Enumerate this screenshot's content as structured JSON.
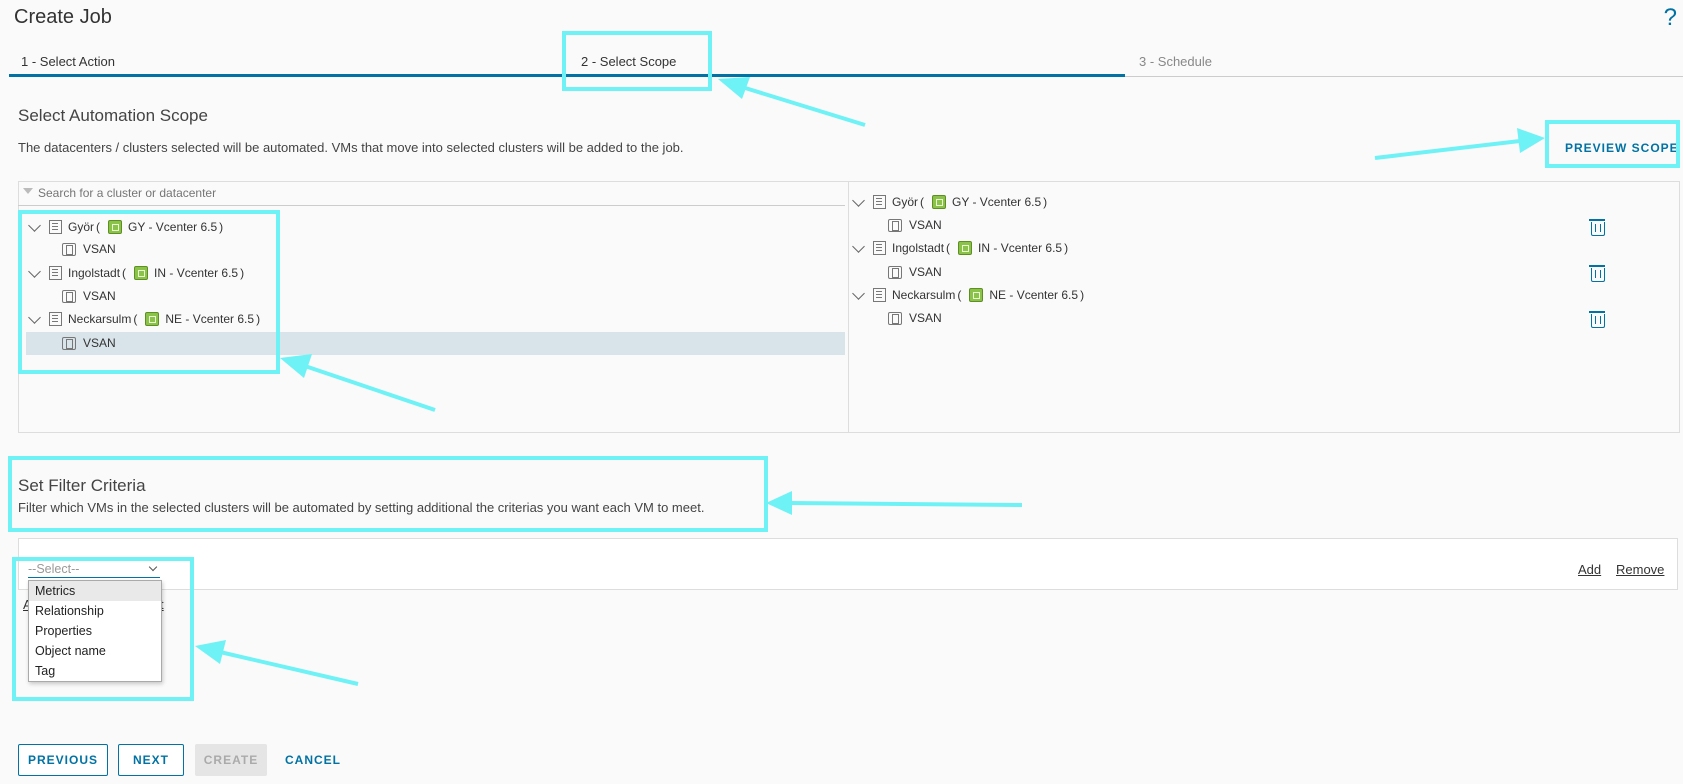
{
  "header": {
    "title": "Create Job",
    "help": "?"
  },
  "steps": [
    {
      "label": "1 - Select Action"
    },
    {
      "label": "2 - Select Scope"
    },
    {
      "label": "3 - Schedule"
    }
  ],
  "scope": {
    "heading": "Select Automation Scope",
    "description": "The datacenters / clusters selected will be automated. VMs that move into selected clusters will be added to the job.",
    "preview_label": "PREVIEW SCOPE",
    "search_placeholder": "Search for a cluster or datacenter"
  },
  "tree": [
    {
      "name": "Györ",
      "vcenter": "GY - Vcenter 6.5",
      "cluster": "VSAN"
    },
    {
      "name": "Ingolstadt",
      "vcenter": "IN - Vcenter 6.5",
      "cluster": "VSAN"
    },
    {
      "name": "Neckarsulm",
      "vcenter": "NE - Vcenter 6.5",
      "cluster": "VSAN"
    }
  ],
  "filter": {
    "heading": "Set Filter Criteria",
    "description": "Filter which VMs in the selected clusters will be automated by setting additional the criterias you want each VM to meet.",
    "select_value": "--Select--",
    "options": [
      "Metrics",
      "Relationship",
      "Properties",
      "Object name",
      "Tag"
    ],
    "add_label": "Add",
    "remove_label": "Remove",
    "hidden_link_left": "A",
    "hidden_link_right": "t"
  },
  "footer": {
    "previous": "PREVIOUS",
    "next": "NEXT",
    "create": "CREATE",
    "cancel": "CANCEL"
  },
  "colors": {
    "accent": "#0072a3",
    "annotation": "#6ff2f5",
    "vcenter": "#8bc34a"
  }
}
